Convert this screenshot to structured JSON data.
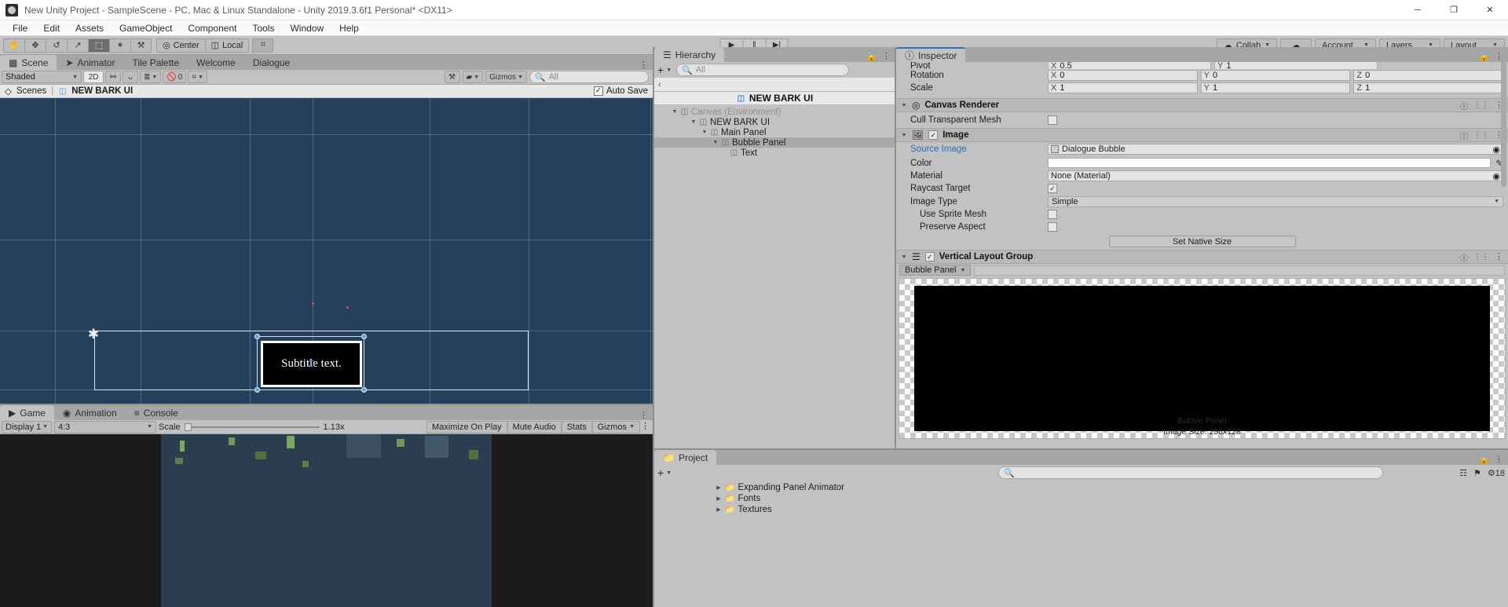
{
  "window": {
    "title": "New Unity Project - SampleScene - PC, Mac & Linux Standalone - Unity 2019.3.6f1 Personal* <DX11>",
    "minimize": "─",
    "maximize": "❐",
    "close": "✕"
  },
  "menu": [
    "File",
    "Edit",
    "Assets",
    "GameObject",
    "Component",
    "Tools",
    "Window",
    "Help"
  ],
  "toolbar": {
    "tools": [
      {
        "name": "hand-tool",
        "glyph": "✋"
      },
      {
        "name": "move-tool",
        "glyph": "✥"
      },
      {
        "name": "rotate-tool",
        "glyph": "↺"
      },
      {
        "name": "scale-tool",
        "glyph": "↗"
      },
      {
        "name": "rect-tool",
        "glyph": "⬚"
      },
      {
        "name": "transform-tool",
        "glyph": "✶"
      },
      {
        "name": "custom-tool",
        "glyph": "⚒"
      }
    ],
    "pivot": "Center",
    "space": "Local",
    "grid_glyph": "⌗",
    "play": "▶",
    "pause": "‖",
    "step": "▶|",
    "collab": "Collab",
    "collab_icon": "☁",
    "cloud_icon": "☁",
    "account": "Account",
    "layers": "Layers",
    "layout": "Layout"
  },
  "scene": {
    "tabs": [
      {
        "label": "Scene",
        "icon": "grid-icon",
        "active": true
      },
      {
        "label": "Animator",
        "icon": "animator-icon",
        "active": false
      },
      {
        "label": "Tile Palette",
        "icon": "",
        "active": false
      },
      {
        "label": "Welcome",
        "icon": "",
        "active": false
      },
      {
        "label": "Dialogue",
        "icon": "",
        "active": false
      }
    ],
    "shading_mode": "Shaded",
    "mode_2d": "2D",
    "light_icon": "⚯",
    "audio_icon": "ᴗ",
    "fx_icon": "≣",
    "hidden_count": "0",
    "grid_icon": "⌗",
    "tools_icon": "⚒",
    "camera_icon": "▰",
    "gizmos": "Gizmos",
    "search_placeholder": "All",
    "breadcrumb_scenes": "Scenes",
    "breadcrumb_current": "NEW BARK UI",
    "autosave_label": "Auto Save",
    "autosave_checked": "✓",
    "bubble_text": "Subtitle text."
  },
  "game": {
    "tabs": [
      {
        "label": "Game",
        "active": true
      },
      {
        "label": "Animation",
        "active": false
      },
      {
        "label": "Console",
        "active": false
      }
    ],
    "display": "Display 1",
    "aspect": "4:3",
    "scale_label": "Scale",
    "scale_value": "1.13x",
    "maximize_on_play": "Maximize On Play",
    "mute_audio": "Mute Audio",
    "stats": "Stats",
    "gizmos": "Gizmos"
  },
  "hierarchy": {
    "tab": "Hierarchy",
    "plus": "+",
    "search_placeholder": "All",
    "back_arrow": "‹",
    "selected_object": "NEW BARK UI",
    "tree": [
      {
        "label": "Canvas (Environment)",
        "depth": 0,
        "expanded": true,
        "dim": true,
        "selected": false
      },
      {
        "label": "NEW BARK UI",
        "depth": 1,
        "expanded": true,
        "dim": false,
        "selected": false
      },
      {
        "label": "Main Panel",
        "depth": 2,
        "expanded": true,
        "dim": false,
        "selected": false
      },
      {
        "label": "Bubble Panel",
        "depth": 3,
        "expanded": true,
        "dim": false,
        "selected": true
      },
      {
        "label": "Text",
        "depth": 4,
        "expanded": false,
        "dim": false,
        "selected": false
      }
    ]
  },
  "inspector": {
    "tab": "Inspector",
    "transform": {
      "pivot_label": "Pivot",
      "pivot_x": "0.5",
      "pivot_y": "1",
      "rotation_label": "Rotation",
      "rotation": {
        "x": "0",
        "y": "0",
        "z": "0"
      },
      "scale_label": "Scale",
      "scale": {
        "x": "1",
        "y": "1",
        "z": "1"
      }
    },
    "canvas_renderer": {
      "title": "Canvas Renderer",
      "cull_transparent_mesh_label": "Cull Transparent Mesh",
      "cull_transparent_mesh_checked": false
    },
    "image": {
      "title": "Image",
      "enabled_check": "✓",
      "source_image_label": "Source Image",
      "source_image_value": "Dialogue Bubble",
      "color_label": "Color",
      "color_value": "#FFFFFF",
      "material_label": "Material",
      "material_value": "None (Material)",
      "raycast_target_label": "Raycast Target",
      "raycast_target_checked": true,
      "image_type_label": "Image Type",
      "image_type_value": "Simple",
      "use_sprite_mesh_label": "Use Sprite Mesh",
      "use_sprite_mesh_checked": false,
      "preserve_aspect_label": "Preserve Aspect",
      "preserve_aspect_checked": false,
      "set_native_size": "Set Native Size"
    },
    "vertical_layout_group": {
      "title": "Vertical Layout Group"
    },
    "preview": {
      "selector": "Bubble Panel",
      "name": "Bubble Panel",
      "size": "Image Size: 256x128"
    }
  },
  "project": {
    "tab": "Project",
    "plus": "+",
    "search_placeholder": "",
    "badge": "18",
    "items": [
      {
        "label": "Expanding Panel Animator",
        "depth": 0
      },
      {
        "label": "Fonts",
        "depth": 0
      },
      {
        "label": "Textures",
        "depth": 0
      }
    ]
  },
  "colors": {
    "scene_bg": "#24405c",
    "accent": "#2c6fbb",
    "panel_bg": "#c2c2c2",
    "game_bg": "#1b1b1b"
  }
}
